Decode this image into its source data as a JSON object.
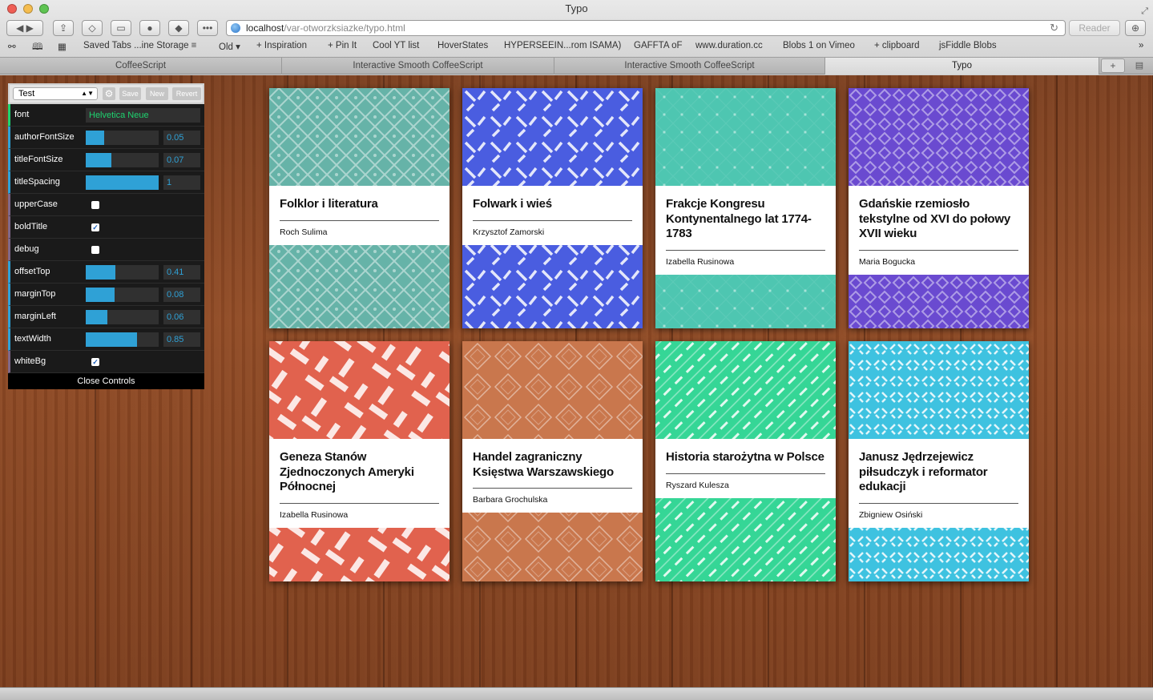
{
  "window": {
    "title": "Typo"
  },
  "toolbar": {
    "url_host": "localhost",
    "url_path": "/var-otworzksiazke/typo.html",
    "reader_label": "Reader"
  },
  "bookmarks": [
    "Saved Tabs ...ine Storage ≡",
    "Old ▾",
    "+ Inspiration",
    "+ Pin It",
    "Cool YT list",
    "HoverStates",
    "HYPERSEEIN...rom ISAMA)",
    "GAFFTA oF",
    "www.duration.cc",
    "Blobs 1 on Vimeo",
    "+ clipboard",
    "jsFiddle Blobs"
  ],
  "tabs": [
    "CoffeeScript",
    "Interactive Smooth CoffeeScript",
    "Interactive Smooth CoffeeScript",
    "Typo"
  ],
  "controls": {
    "preset": "Test",
    "save_label": "Save",
    "new_label": "New",
    "revert_label": "Revert",
    "font_label": "font",
    "font_value": "Helvetica Neue",
    "sliders": [
      {
        "label": "authorFontSize",
        "value": "0.05",
        "fraction": 0.25
      },
      {
        "label": "titleFontSize",
        "value": "0.07",
        "fraction": 0.35
      },
      {
        "label": "titleSpacing",
        "value": "1",
        "fraction": 1.0
      },
      {
        "label": "offsetTop",
        "value": "0.41",
        "fraction": 0.41
      },
      {
        "label": "marginTop",
        "value": "0.08",
        "fraction": 0.4
      },
      {
        "label": "marginLeft",
        "value": "0.06",
        "fraction": 0.3
      },
      {
        "label": "textWidth",
        "value": "0.85",
        "fraction": 0.7
      }
    ],
    "toggles": [
      {
        "label": "upperCase",
        "checked": false
      },
      {
        "label": "boldTitle",
        "checked": true
      },
      {
        "label": "debug",
        "checked": false
      },
      {
        "label": "whiteBg",
        "checked": true
      }
    ],
    "close_label": "Close Controls"
  },
  "books": [
    {
      "title": "Folklor i literatura",
      "author": "Roch Sulima",
      "color": "#66b3a8",
      "pattern": "diamond-lattice"
    },
    {
      "title": "Folwark i wieś",
      "author": "Krzysztof Zamorski",
      "color": "#4a5de0",
      "pattern": "dashes"
    },
    {
      "title": "Frakcje Kongresu Kontynentalnego lat 1774-1783",
      "author": "Izabella Rusinowa",
      "color": "#4ec6b1",
      "pattern": "dots"
    },
    {
      "title": "Gdańskie rzemiosło tekstylne od XVI do połowy XVII wieku",
      "author": "Maria Bogucka",
      "color": "#6a4ad0",
      "pattern": "diamond-small"
    },
    {
      "title": "Geneza Stanów Zjednoczonych Ameryki Północnej",
      "author": "Izabella Rusinowa",
      "color": "#e1624e",
      "pattern": "weave"
    },
    {
      "title": "Handel zagraniczny Księstwa Warszawskiego",
      "author": "Barbara Grochulska",
      "color": "#c9774d",
      "pattern": "diamond-outline"
    },
    {
      "title": "Historia starożytna w Polsce",
      "author": "Ryszard Kulesza",
      "color": "#35d696",
      "pattern": "diagonal-lines"
    },
    {
      "title": "Janusz Jędrzejewicz piłsudczyk i reformator edukacji",
      "author": "Zbigniew Osiński",
      "color": "#3ec2e0",
      "pattern": "zigzag"
    }
  ]
}
